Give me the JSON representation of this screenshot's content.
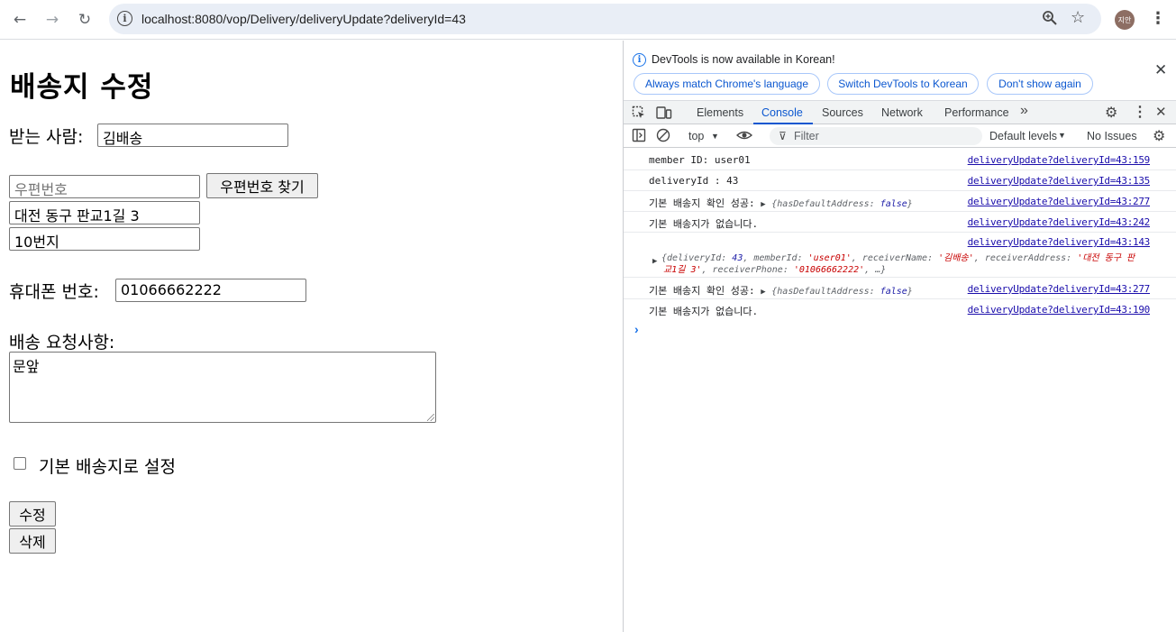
{
  "browser": {
    "url": "localhost:8080/vop/Delivery/deliveryUpdate?deliveryId=43",
    "avatar_text": "지안"
  },
  "page": {
    "title": "배송지 수정",
    "receiver_label": "받는 사람:",
    "receiver_value": "김배송",
    "zipcode_placeholder": "우편번호",
    "zipcode_button": "우편번호 찾기",
    "address_value": "대전 동구 판교1길 3",
    "address_detail_value": "10번지",
    "phone_label": "휴대폰 번호:",
    "phone_value": "01066662222",
    "request_label": "배송 요청사항:",
    "request_value": "문앞",
    "default_checkbox_label": "기본 배송지로 설정",
    "default_checked": false,
    "update_button": "수정",
    "delete_button": "삭제"
  },
  "devtools": {
    "notice_text": "DevTools is now available in Korean!",
    "notice_buttons": [
      "Always match Chrome's language",
      "Switch DevTools to Korean",
      "Don't show again"
    ],
    "tabs": [
      "Elements",
      "Console",
      "Sources",
      "Network",
      "Performance"
    ],
    "active_tab": "Console",
    "context": "top",
    "filter_placeholder": "Filter",
    "levels": "Default levels",
    "issues": "No Issues",
    "console_rows": [
      {
        "text": "member ID: user01",
        "source": "deliveryUpdate?deliveryId=43:159"
      },
      {
        "text": "deliveryId : 43",
        "source": "deliveryUpdate?deliveryId=43:135"
      },
      {
        "text": "기본 배송지 확인 성공:",
        "source": "deliveryUpdate?deliveryId=43:277"
      },
      {
        "text": "기본 배송지가 없습니다.",
        "source": "deliveryUpdate?deliveryId=43:242"
      },
      {
        "text": "",
        "source": "deliveryUpdate?deliveryId=43:143"
      },
      {
        "text": "기본 배송지 확인 성공:",
        "source": "deliveryUpdate?deliveryId=43:277"
      },
      {
        "text": "기본 배송지가 없습니다.",
        "source": "deliveryUpdate?deliveryId=43:190"
      }
    ],
    "obj_default": {
      "key": "hasDefaultAddress",
      "value": "false"
    },
    "obj_delivery": {
      "deliveryId_key": "deliveryId",
      "deliveryId_val": "43",
      "memberId_key": "memberId",
      "memberId_val": "'user01'",
      "receiverName_key": "receiverName",
      "receiverName_val": "'김배송'",
      "receiverAddress_key": "receiverAddress",
      "receiverAddress_val_1": "'대전 동구 판",
      "receiverAddress_val_2": "교1길 3'",
      "receiverPhone_key": "receiverPhone",
      "receiverPhone_val": "'01066662222'",
      "ellipsis": "…"
    }
  }
}
